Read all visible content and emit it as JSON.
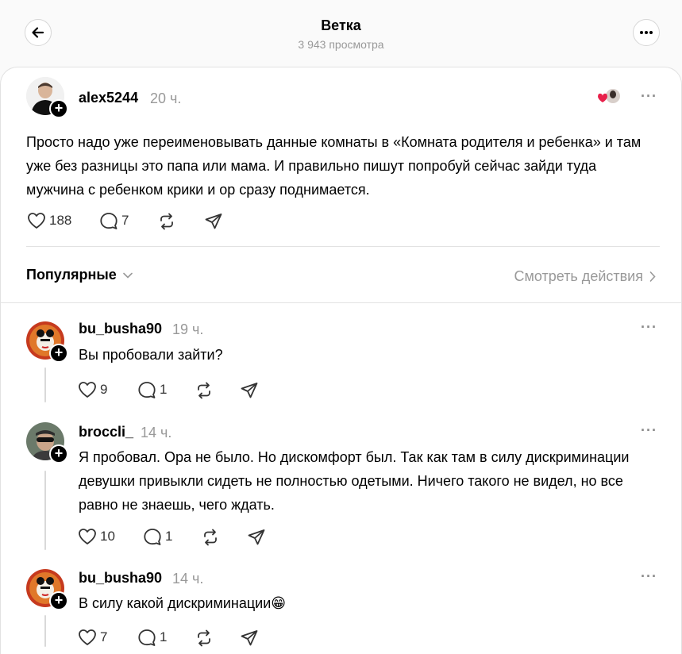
{
  "header": {
    "title": "Ветка",
    "views": "3 943 просмотра",
    "back_icon": "arrow-left-icon",
    "more_icon": "more-horizontal-icon"
  },
  "post": {
    "username": "alex5244",
    "time": "20 ч.",
    "text": "Просто надо уже переименовывать данные комнаты в «Комната родителя и ребенка» и там уже без разницы это папа или мама. И правильно пишут попробуй сейчас зайди туда мужчина с ребенком крики и ор сразу поднимается.",
    "likes": "188",
    "replies": "7"
  },
  "sort": {
    "label": "Популярные",
    "see_activity": "Смотреть действия"
  },
  "comments": [
    {
      "username": "bu_busha90",
      "time": "19 ч.",
      "text": "Вы пробовали зайти?",
      "likes": "9",
      "replies": "1"
    },
    {
      "username": "broccli_",
      "time": "14 ч.",
      "text": "Я пробовал. Ора не было. Но дискомфорт был. Так как там в силу дискриминации девушки привыкли сидеть не полностью одетыми. Ничего такого не видел, но все равно не знаешь, чего ждать.",
      "likes": "10",
      "replies": "1"
    },
    {
      "username": "bu_busha90",
      "time": "14 ч.",
      "text": "В силу какой дискриминации😁",
      "likes": "7",
      "replies": "1"
    }
  ],
  "colors": {
    "heart": "#e8214b",
    "muted": "#999999",
    "border": "#e2e2e2"
  }
}
